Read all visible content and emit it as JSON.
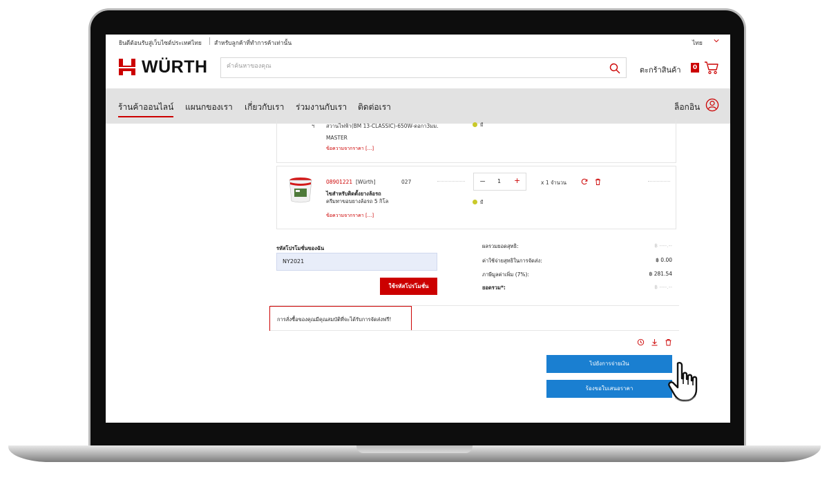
{
  "topbar": {
    "welcome": "ยินดีต้อนรับสู่เว็บไซต์ประเทศไทย",
    "customers_only": "สำหรับลูกค้าที่ทำการค้าเท่านั้น",
    "language": "ไทย"
  },
  "header": {
    "logo_text": "WÜRTH",
    "search_placeholder": "คำค้นหาของคุณ",
    "cart_label": "ตะกร้าสินค้า",
    "cart_count": "0"
  },
  "nav": {
    "items": [
      "ร้านค้าออนไลน์",
      "แผนกของเรา",
      "เกี่ยวกับเรา",
      "ร่วมงานกับเรา",
      "ติดต่อเรา"
    ],
    "login": "ล็อกอิน"
  },
  "cart_items": [
    {
      "number_cut": "ฯ",
      "description_cut": "สวานไฟฟ้า(BM 13-CLASSIC)-650W-ดอกา3มม.",
      "variant": "MASTER",
      "more_link": "ข้อความจากราคา [...]",
      "availability": "มี"
    },
    {
      "article_no": "08901221",
      "brand": "[Würth]",
      "code": "027",
      "name_line1": "ไขสำหรับติดตั้งยางล้อรถ",
      "name_line2": "ครีมทาขอบยางล้อรถ 5 กิโล",
      "more_link": "ข้อความจากราคา [...]",
      "quantity": "1",
      "unit": "x 1 จำนวน",
      "availability": "มี"
    }
  ],
  "promo": {
    "label": "รหัสโปรโมชั่นของฉัน",
    "value": "NY2021",
    "apply_button": "ใช้รหัสโปรโมชั่น"
  },
  "summary": {
    "net_label": "ผลรวมยอดสุทธิ:",
    "net_value": "฿ ----.--",
    "shipping_label": "ค่าใช้จ่ายสุทธิในการจัดส่ง:",
    "shipping_value": "฿ 0.00",
    "vat_label": "ภาษีมูลค่าเพิ่ม (7%):",
    "vat_value": "฿ 281.54",
    "total_label": "ยอดรวม*:",
    "total_value": "฿ ----.--"
  },
  "notice": "การสั่งซื้อของคุณมีคุณสมบัติที่จะได้รับการจัดส่งฟรี!",
  "actions": {
    "checkout_button": "ไปยังการจ่ายเงิน",
    "quote_button": "ร้องขอใบเสนอราคา"
  },
  "colors": {
    "brand_red": "#cc0000",
    "action_blue": "#1a7fd1",
    "nav_gray": "#e2e2e2"
  }
}
